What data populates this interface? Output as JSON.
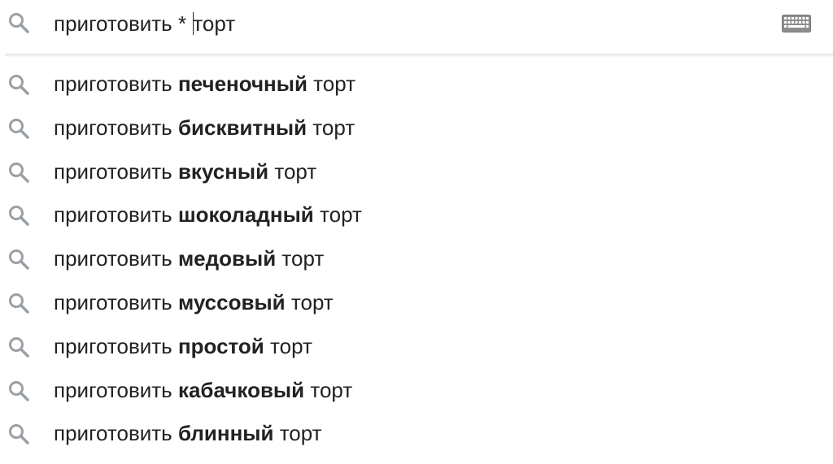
{
  "search": {
    "query_before_caret": "приготовить * ",
    "query_after_caret": "торт",
    "icon": "search-icon",
    "keyboard_icon": "keyboard-icon"
  },
  "suggestions": [
    {
      "prefix": "приготовить ",
      "bold": "печеночный",
      "suffix": " торт"
    },
    {
      "prefix": "приготовить ",
      "bold": "бисквитный",
      "suffix": " торт"
    },
    {
      "prefix": "приготовить ",
      "bold": "вкусный",
      "suffix": " торт"
    },
    {
      "prefix": "приготовить ",
      "bold": "шоколадный",
      "suffix": " торт"
    },
    {
      "prefix": "приготовить ",
      "bold": "медовый",
      "suffix": " торт"
    },
    {
      "prefix": "приготовить ",
      "bold": "муссовый",
      "suffix": " торт"
    },
    {
      "prefix": "приготовить ",
      "bold": "простой",
      "suffix": " торт"
    },
    {
      "prefix": "приготовить ",
      "bold": "кабачковый",
      "suffix": " торт"
    },
    {
      "prefix": "приготовить ",
      "bold": "блинный",
      "suffix": " торт"
    }
  ],
  "colors": {
    "text": "#222222",
    "icon": "#9aa0a6",
    "divider": "#e8e8e8"
  }
}
